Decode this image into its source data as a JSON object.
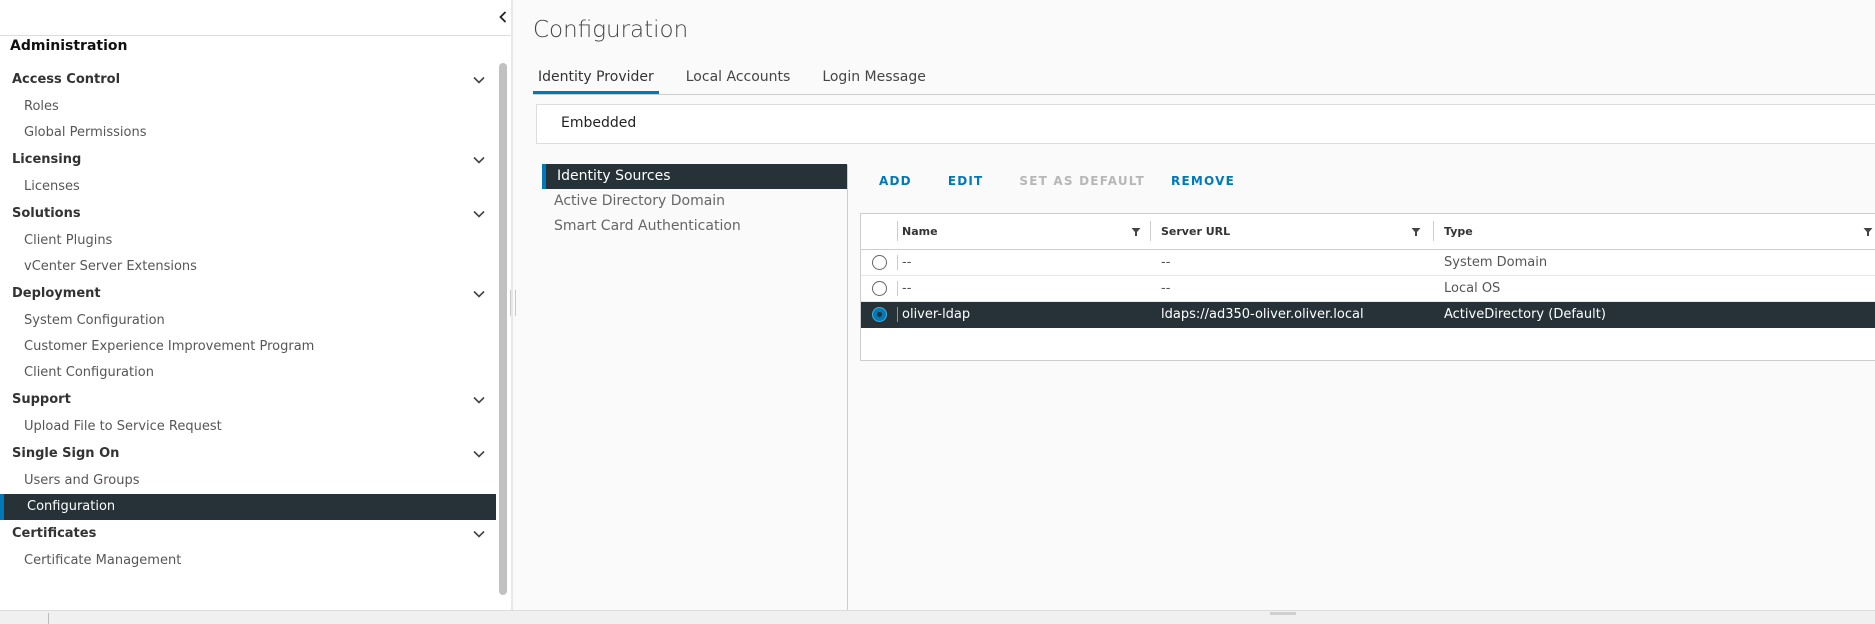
{
  "sidebar": {
    "title": "Administration",
    "groups": [
      {
        "label": "Access Control",
        "items": [
          "Roles",
          "Global Permissions"
        ]
      },
      {
        "label": "Licensing",
        "items": [
          "Licenses"
        ]
      },
      {
        "label": "Solutions",
        "items": [
          "Client Plugins",
          "vCenter Server Extensions"
        ]
      },
      {
        "label": "Deployment",
        "items": [
          "System Configuration",
          "Customer Experience Improvement Program",
          "Client Configuration"
        ]
      },
      {
        "label": "Support",
        "items": [
          "Upload File to Service Request"
        ]
      },
      {
        "label": "Single Sign On",
        "items": [
          "Users and Groups",
          "Configuration"
        ]
      },
      {
        "label": "Certificates",
        "items": [
          "Certificate Management"
        ]
      }
    ],
    "active_item": "Configuration"
  },
  "main": {
    "title": "Configuration",
    "tabs": [
      "Identity Provider",
      "Local Accounts",
      "Login Message"
    ],
    "active_tab": "Identity Provider",
    "provider": "Embedded",
    "subnav": [
      "Identity Sources",
      "Active Directory Domain",
      "Smart Card Authentication"
    ],
    "active_subnav": "Identity Sources",
    "actions": {
      "add": "ADD",
      "edit": "EDIT",
      "set_default": "SET AS DEFAULT",
      "remove": "REMOVE"
    },
    "grid": {
      "columns": [
        "Name",
        "Server URL",
        "Type"
      ],
      "rows": [
        {
          "name": "--",
          "url": "--",
          "type": "System Domain",
          "selected": false
        },
        {
          "name": "--",
          "url": "--",
          "type": "Local OS",
          "selected": false
        },
        {
          "name": "oliver-ldap",
          "url": "ldaps://ad350-oliver.oliver.local",
          "type": "ActiveDirectory (Default)",
          "selected": true
        }
      ]
    }
  },
  "colors": {
    "accent": "#0079b8",
    "selected_bg": "#263238"
  }
}
